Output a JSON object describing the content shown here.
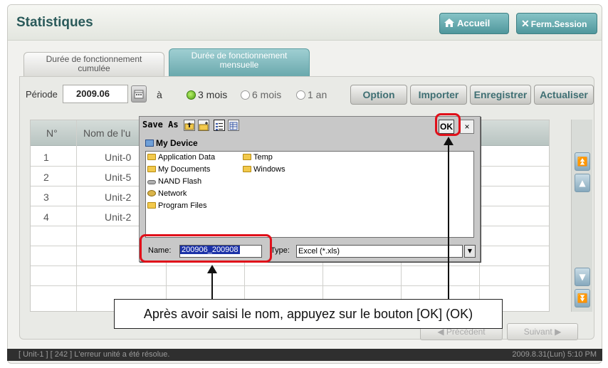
{
  "app": {
    "title": "Statistiques",
    "home_label": "Accueil",
    "logout_label": "Ferm.Session"
  },
  "tabs": [
    {
      "label_line1": "Durée de fonctionnement",
      "label_line2": "cumulée"
    },
    {
      "label_line1": "Durée de fonctionnement",
      "label_line2": "mensuelle",
      "active": true
    }
  ],
  "period": {
    "label": "Période",
    "value": "2009.06",
    "a_label": "à",
    "options": [
      "3 mois",
      "6 mois",
      "1 an"
    ],
    "selected_option": "3 mois"
  },
  "buttons": {
    "option": "Option",
    "import": "Importer",
    "save": "Enregistrer",
    "refresh": "Actualiser"
  },
  "table": {
    "headers": [
      "N°",
      "Nom de l'u"
    ],
    "rows": [
      {
        "num": "1",
        "name": "Unit-0"
      },
      {
        "num": "2",
        "name": "Unit-5"
      },
      {
        "num": "3",
        "name": "Unit-2"
      },
      {
        "num": "4",
        "name": "Unit-2"
      }
    ]
  },
  "pager": {
    "prev": "Précédent",
    "next": "Suivant"
  },
  "dialog": {
    "title": "Save As",
    "ok": "OK",
    "close": "×",
    "location": "My Device",
    "files_col1": [
      "Application Data",
      "My Documents",
      "NAND Flash",
      "Network",
      "Program Files"
    ],
    "files_col2": [
      "Temp",
      "Windows"
    ],
    "name_label": "Name:",
    "name_value": "200906_200908",
    "type_label": "Type:",
    "type_value": "Excel (*.xls)"
  },
  "callout": "Après avoir saisi le nom, appuyez sur le bouton [OK] (OK)",
  "status": {
    "message": "[ Unit-1 ] [ 242 ] L'erreur unité a été résolue.",
    "datetime": "2009.8.31(Lun)  5:10 PM"
  },
  "colors": {
    "accent": "#5fa7ab",
    "highlight_red": "#e0101a",
    "selection_blue": "#1c32a8"
  }
}
